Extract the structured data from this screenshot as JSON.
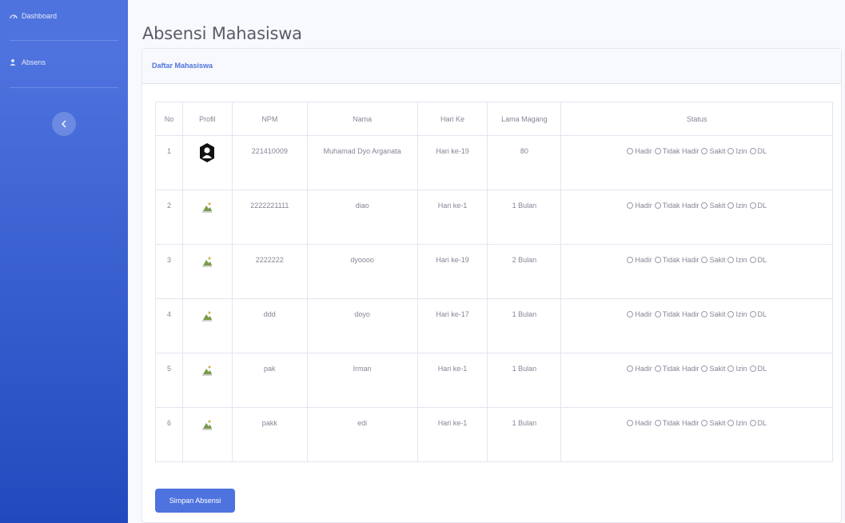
{
  "sidebar": {
    "items": [
      {
        "label": "Dashboard",
        "icon": "gauge-icon"
      },
      {
        "label": "Absens",
        "icon": "users-icon"
      }
    ],
    "toggle_icon": "chevron-left-icon"
  },
  "page": {
    "title": "Absensi Mahasiswa"
  },
  "card": {
    "header": "Daftar Mahasiswa"
  },
  "table": {
    "headers": [
      "No",
      "Profil",
      "NPM",
      "Nama",
      "Hari Ke",
      "Lama Magang",
      "Status"
    ],
    "status_options": [
      "Hadir",
      "Tidak Hadir",
      "Sakit",
      "Izin",
      "DL"
    ],
    "rows": [
      {
        "no": "1",
        "profil": "avatar",
        "npm": "221410009",
        "nama": "Muhamad Dyo Arganata",
        "hari": "Hari ke-19",
        "lama": "80"
      },
      {
        "no": "2",
        "profil": "image",
        "npm": "2222221111",
        "nama": "diao",
        "hari": "Hari ke-1",
        "lama": "1 Bulan"
      },
      {
        "no": "3",
        "profil": "image",
        "npm": "2222222",
        "nama": "dyoooo",
        "hari": "Hari ke-19",
        "lama": "2 Bulan"
      },
      {
        "no": "4",
        "profil": "image",
        "npm": "ddd",
        "nama": "doyo",
        "hari": "Hari ke-17",
        "lama": "1 Bulan"
      },
      {
        "no": "5",
        "profil": "image",
        "npm": "pak",
        "nama": "Irman",
        "hari": "Hari ke-1",
        "lama": "1 Bulan"
      },
      {
        "no": "6",
        "profil": "image",
        "npm": "pakk",
        "nama": "edi",
        "hari": "Hari ke-1",
        "lama": "1 Bulan"
      }
    ]
  },
  "actions": {
    "save_label": "Simpan Absensi"
  },
  "colors": {
    "primary": "#4e73df",
    "sidebar_end": "#224abe",
    "text_muted": "#858796"
  }
}
